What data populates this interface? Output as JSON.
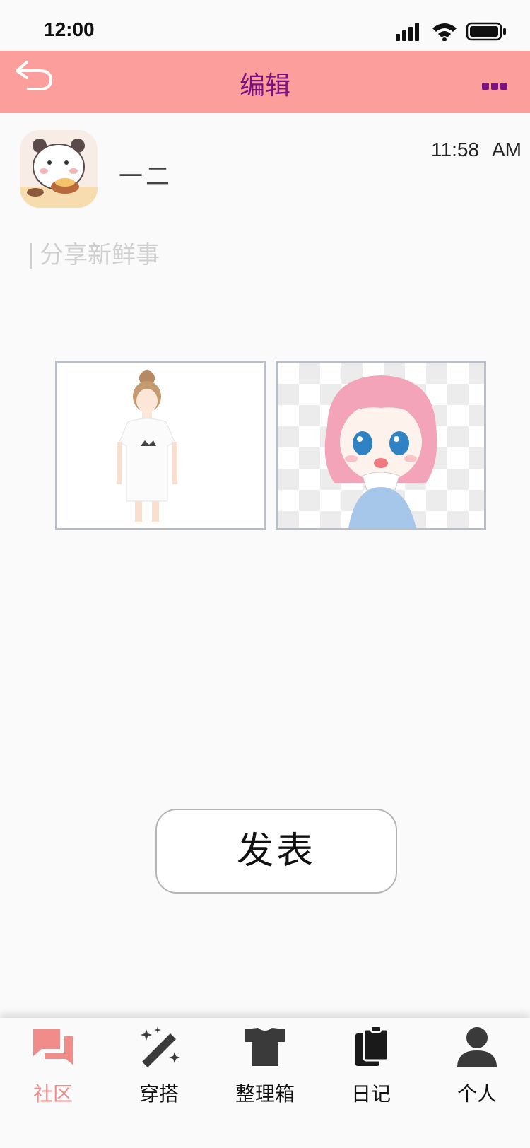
{
  "status_bar": {
    "time": "12:00"
  },
  "nav": {
    "title": "编辑"
  },
  "post": {
    "author_name": "一二",
    "time": "11:58",
    "time_suffix": "AM",
    "placeholder": "分享新鲜事"
  },
  "actions": {
    "publish_label": "发表"
  },
  "tabs": [
    {
      "label": "社区",
      "icon": "chat-icon",
      "active": true
    },
    {
      "label": "穿搭",
      "icon": "magic-wand-icon",
      "active": false
    },
    {
      "label": "整理箱",
      "icon": "shirt-icon",
      "active": false
    },
    {
      "label": "日记",
      "icon": "clipboard-icon",
      "active": false
    },
    {
      "label": "个人",
      "icon": "person-icon",
      "active": false
    }
  ],
  "colors": {
    "nav_bg": "#fc9e9c",
    "title": "#7b1283",
    "active_tab": "#f08d8a"
  }
}
